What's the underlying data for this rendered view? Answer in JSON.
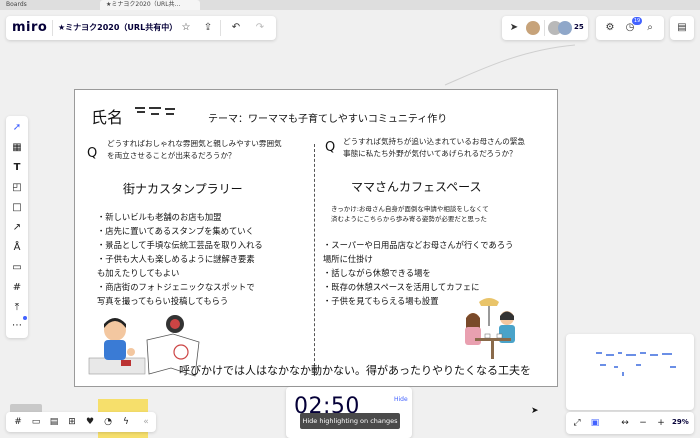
{
  "browser": {
    "tabs": [
      {
        "label": "Boards"
      },
      {
        "label": "★ミナヨク2020（URL共..."
      }
    ]
  },
  "topbar": {
    "logo": "miro",
    "board_title": "★ミナヨク2020（URL共有中）",
    "star_icon": "star-icon",
    "share_icon": "upload-icon",
    "undo_icon": "undo-icon",
    "redo_icon": "redo-icon"
  },
  "collaborators": {
    "count": "25",
    "avatar_colors": [
      "#c7a37a",
      "#b9b9b9",
      "#8fa7c9"
    ]
  },
  "right_tools": {
    "notification_count": "19"
  },
  "frame": {
    "name_label": "氏名",
    "theme": "テーマ：ワーママも子育てしやすいコミュニティ作り",
    "left": {
      "q_label": "Q",
      "question": [
        "どうすればおしゃれな雰囲気と親しみやすい雰囲気",
        "を両立させることが出来るだろうか？"
      ],
      "heading": "街ナカスタンプラリー",
      "ideas": [
        "・新しいビルも老舗のお店も加盟",
        "・店先に置いてあるスタンプを集めていく",
        "・景品として手頃な伝統工芸品を取り入れる",
        "・子供も大人も楽しめるように謎解き要素",
        "も加えたりしてもよい",
        "・商店街のフォトジェニックなスポットで",
        "写真を撮ってもらい投稿してもらう"
      ]
    },
    "right": {
      "q_label": "Q",
      "question": [
        "どうすれば気持ちが追い込まれているお母さんの緊急",
        "事態に私たち外野が気付いてあげられるだろうか？"
      ],
      "heading": "ママさんカフェスペース",
      "trigger": [
        "きっかけ:お母さん自身が面倒な申請や相談をしなくて",
        "済むようにこちらから歩み寄る姿勢が必要だと思った"
      ],
      "ideas": [
        "・スーパーや日用品店などお母さんが行くであろう",
        "場所に仕掛け",
        "・話しながら休憩できる場を",
        "・既存の休憩スペースを活用してカフェに",
        "・子供を見てもらえる場も設置"
      ]
    },
    "footer": "呼びかけでは人はなかなか動かない。得があったりやりたくなる工夫を"
  },
  "timer": {
    "value": "02:50",
    "hide_label": "Hide",
    "tooltip": "Hide highlighting on changes"
  },
  "zoom": {
    "value": "29%"
  },
  "colors": {
    "accent": "#4262ff",
    "sticky": "#f6df6b",
    "brand": "#050038"
  }
}
